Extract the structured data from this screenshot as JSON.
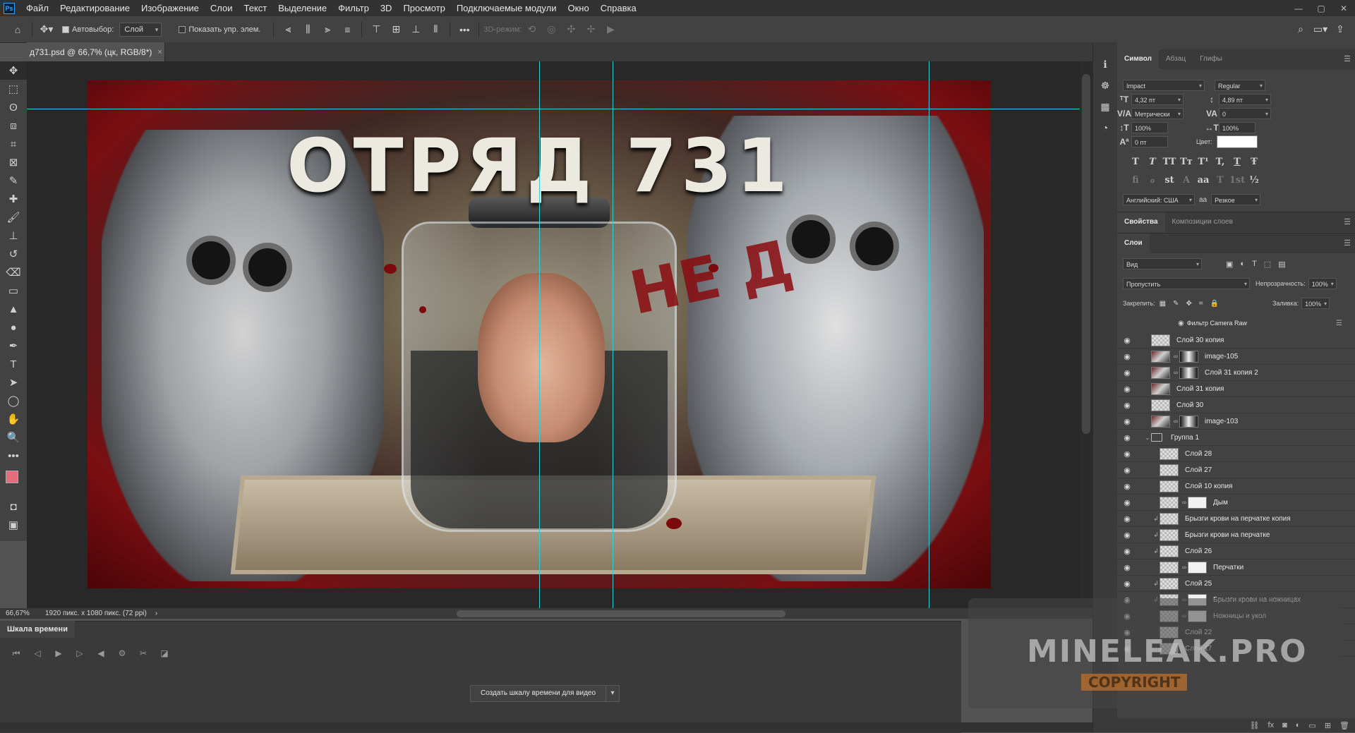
{
  "menu": {
    "items": [
      "Файл",
      "Редактирование",
      "Изображение",
      "Слои",
      "Текст",
      "Выделение",
      "Фильтр",
      "3D",
      "Просмотр",
      "Подключаемые модули",
      "Окно",
      "Справка"
    ],
    "window_controls": [
      "—",
      "▢",
      "✕"
    ]
  },
  "options": {
    "autoselect_label": "Автовыбор:",
    "autoselect_checked": true,
    "autoselect_target": "Слой",
    "show_controls_label": "Показать упр. элем.",
    "show_controls_checked": false,
    "mode_3d_label": "3D-режим:"
  },
  "document": {
    "tab_title": "д731.psd @ 66,7% (цк, RGB/8*)",
    "close": "×"
  },
  "image": {
    "title_text": "ОТРЯД 731",
    "overlay_text": "НЕ Д"
  },
  "status": {
    "zoom": "66,67%",
    "doc_info": "1920 пикс. x 1080 пикс. (72 ppi)",
    "arrow": "›"
  },
  "timeline": {
    "tab_label": "Шкала времени",
    "create_button": "Создать шкалу времени для видео"
  },
  "character_panel": {
    "tabs": [
      "Символ",
      "Абзац",
      "Глифы"
    ],
    "font_family": "Impact",
    "font_style": "Regular",
    "font_size": "4,32 пт",
    "leading": "4,89 пт",
    "kerning": "Метрически",
    "tracking": "0",
    "vertical_scale": "100%",
    "horizontal_scale": "100%",
    "baseline_shift": "0 пт",
    "color_label": "Цвет:",
    "color_value": "#ffffff",
    "language": "Английский: США",
    "antialias_label": "aa",
    "antialias": "Резкое",
    "style_buttons": [
      "T",
      "T",
      "TT",
      "Tт",
      "T¹",
      "T,",
      "T",
      "Ŧ"
    ],
    "opentype_buttons": [
      "fi",
      "ℴ",
      "st",
      "A",
      "aa",
      "T",
      "1st",
      "½"
    ]
  },
  "properties_panel": {
    "tabs": [
      "Свойства",
      "Композиции слоев"
    ]
  },
  "layers_panel": {
    "tab": "Слои",
    "filter_kind": "Вид",
    "blend_mode": "Пропустить",
    "opacity_label": "Непрозрачность:",
    "opacity": "100%",
    "lock_label": "Закрепить:",
    "fill_label": "Заливка:",
    "fill": "100%",
    "filter_entry": "Фильтр Camera Raw",
    "layers": [
      {
        "name": "Слой 30 копия",
        "thumb": "checker",
        "mask": false,
        "visible": true,
        "indent": 0,
        "clip": false
      },
      {
        "name": "image-105",
        "thumb": "img",
        "mask": true,
        "visible": true,
        "indent": 0,
        "clip": false
      },
      {
        "name": "Слой 31 копия 2",
        "thumb": "img",
        "mask": true,
        "visible": true,
        "indent": 0,
        "clip": false
      },
      {
        "name": "Слой 31 копия",
        "thumb": "img",
        "mask": false,
        "visible": true,
        "indent": 0,
        "clip": false
      },
      {
        "name": "Слой 30",
        "thumb": "checker",
        "mask": false,
        "visible": true,
        "indent": 0,
        "clip": false
      },
      {
        "name": "image-103",
        "thumb": "img",
        "mask": true,
        "visible": true,
        "indent": 0,
        "clip": false
      },
      {
        "name": "Группа 1",
        "thumb": "folder",
        "mask": false,
        "visible": true,
        "indent": 0,
        "clip": false
      },
      {
        "name": "Слой 28",
        "thumb": "checker",
        "mask": false,
        "visible": true,
        "indent": 1,
        "clip": false
      },
      {
        "name": "Слой 27",
        "thumb": "checker",
        "mask": false,
        "visible": true,
        "indent": 1,
        "clip": false
      },
      {
        "name": "Слой 10 копия",
        "thumb": "checker",
        "mask": false,
        "visible": true,
        "indent": 1,
        "clip": false
      },
      {
        "name": "Дым",
        "thumb": "checker",
        "mask": true,
        "visible": true,
        "indent": 1,
        "clip": false
      },
      {
        "name": "Брызги крови на перчатке копия",
        "thumb": "checker",
        "mask": false,
        "visible": true,
        "indent": 1,
        "clip": true
      },
      {
        "name": "Брызги крови на перчатке",
        "thumb": "checker",
        "mask": false,
        "visible": true,
        "indent": 1,
        "clip": true
      },
      {
        "name": "Слой 26",
        "thumb": "checker",
        "mask": false,
        "visible": true,
        "indent": 1,
        "clip": true
      },
      {
        "name": "Перчатки",
        "thumb": "checker",
        "mask": true,
        "visible": true,
        "indent": 1,
        "clip": false
      },
      {
        "name": "Слой 25",
        "thumb": "checker",
        "mask": false,
        "visible": true,
        "indent": 1,
        "clip": true
      },
      {
        "name": "Брызги крови на ножницах",
        "thumb": "checker",
        "mask": true,
        "visible": true,
        "indent": 1,
        "clip": true
      },
      {
        "name": "Ножницы и укол",
        "thumb": "checker",
        "mask": true,
        "visible": true,
        "indent": 1,
        "clip": false
      },
      {
        "name": "Слой 22",
        "thumb": "checker",
        "mask": false,
        "visible": true,
        "indent": 1,
        "clip": false
      },
      {
        "name": "Слой 17",
        "thumb": "checker",
        "mask": false,
        "visible": true,
        "indent": 1,
        "clip": false
      }
    ]
  },
  "watermark": {
    "text": "MINELEAK.PRO",
    "sub": "COPYRIGHT"
  },
  "colors": {
    "guide": "#2fd0d8",
    "foreground": "#e46c7c",
    "background": "#ffffff"
  }
}
